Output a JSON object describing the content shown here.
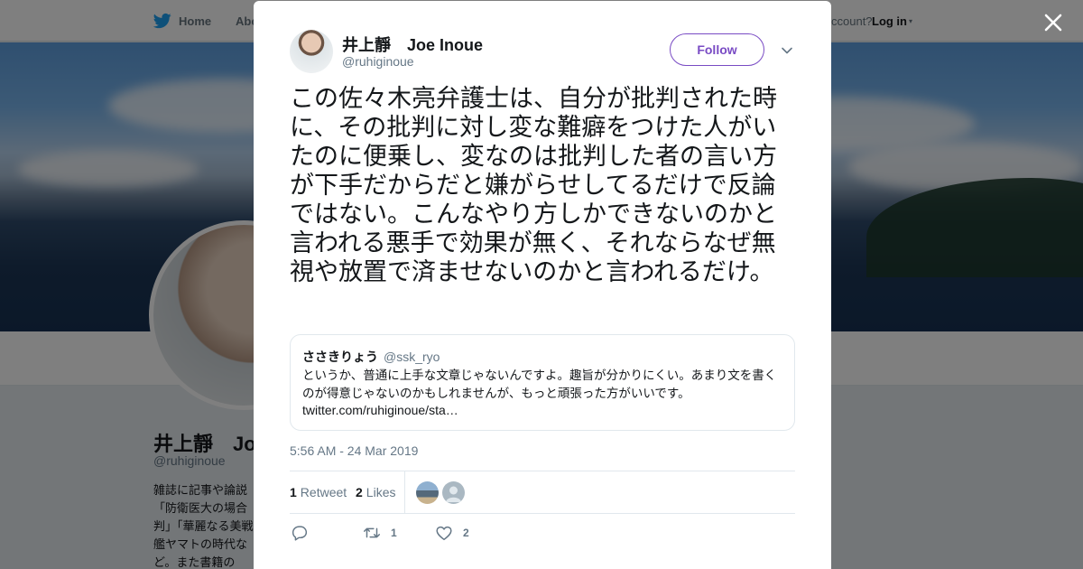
{
  "nav": {
    "home_label": "Home",
    "about_label": "Abo",
    "account_text": "ccount?",
    "login_label": "Log in",
    "login_caret": "▾"
  },
  "profile": {
    "name": "井上靜　Joe",
    "handle": "@ruhiginoue",
    "bio": "雑誌に記事や論説「防衛医大の場合判」「華麗なる美戦艦ヤマトの時代など。また書籍の"
  },
  "tweet": {
    "author_name": "井上靜　Joe Inoue",
    "author_handle": "@ruhiginoue",
    "follow_label": "Follow",
    "text": "この佐々木亮弁護士は、自分が批判された時に、その批判に対し変な難癖をつけた人がいたのに便乗し、変なのは批判した者の言い方が下手だからだと嫌がらせしてるだけで反論ではない。こんなやり方しかできないのかと言われる悪手で効果が無く、それならなぜ無視や放置で済ませないのかと言われるだけ。",
    "quote": {
      "name": "ささきりょう",
      "handle": "@ssk_ryo",
      "text": "というか、普通に上手な文章じゃないんですよ。趣旨が分かりにくい。あまり文を書くのが得意じゃないのかもしれませんが、もっと頑張った方がいいです。",
      "link": "twitter.com/ruhiginoue/sta…"
    },
    "timestamp": "5:56 AM - 24 Mar 2019",
    "stats": {
      "retweet_count": "1",
      "retweet_label": "Retweet",
      "like_count": "2",
      "like_label": "Likes"
    },
    "actions": {
      "retweet_count": "1",
      "like_count": "2"
    }
  },
  "colors": {
    "brand": "#1da1f2",
    "follow_accent": "#794bc4",
    "muted_text": "#657786"
  }
}
